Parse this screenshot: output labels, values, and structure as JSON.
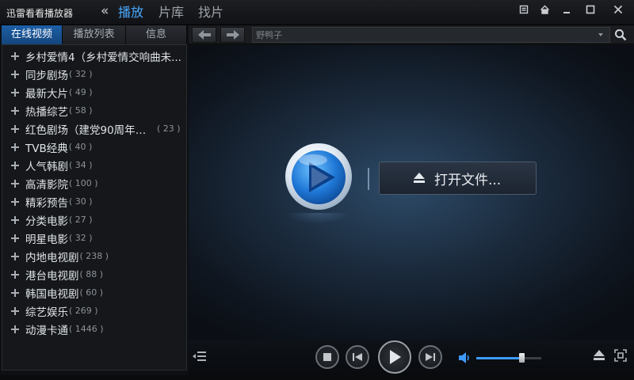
{
  "window": {
    "title": "迅雷看看播放器",
    "tabs": [
      {
        "label": "播放",
        "active": true
      },
      {
        "label": "片库",
        "active": false
      },
      {
        "label": "找片",
        "active": false
      }
    ],
    "controls": [
      "menu-icon",
      "home-icon",
      "minimize-icon",
      "maximize-icon",
      "close-icon"
    ]
  },
  "sidebar": {
    "tabs": [
      {
        "label": "在线视频",
        "active": true
      },
      {
        "label": "播放列表",
        "active": false
      },
      {
        "label": "信息",
        "active": false
      }
    ],
    "categories": [
      {
        "name": "乡村爱情4（乡村爱情交响曲未...",
        "count": ""
      },
      {
        "name": "同步剧场",
        "count": "( 32 )"
      },
      {
        "name": "最新大片",
        "count": "( 49 )"
      },
      {
        "name": "热播综艺",
        "count": "( 58 )"
      },
      {
        "name": "红色剧场（建党90周年献...",
        "count": "( 23 )"
      },
      {
        "name": "TVB经典",
        "count": "( 40 )"
      },
      {
        "name": "人气韩剧",
        "count": "( 34 )"
      },
      {
        "name": "高清影院",
        "count": "( 100 )"
      },
      {
        "name": "精彩预告",
        "count": "( 30 )"
      },
      {
        "name": "分类电影",
        "count": "( 27 )"
      },
      {
        "name": "明星电影",
        "count": "( 32 )"
      },
      {
        "name": "内地电视剧",
        "count": "( 238 )"
      },
      {
        "name": "港台电视剧",
        "count": "( 88 )"
      },
      {
        "name": "韩国电视剧",
        "count": "( 60 )"
      },
      {
        "name": "综艺娱乐",
        "count": "( 269 )"
      },
      {
        "name": "动漫卡通",
        "count": "( 1446 )"
      }
    ]
  },
  "search": {
    "placeholder": "野鸭子"
  },
  "player": {
    "open_file_label": "打开文件...",
    "volume_level": 0.7,
    "accent_color": "#3d9bff"
  }
}
